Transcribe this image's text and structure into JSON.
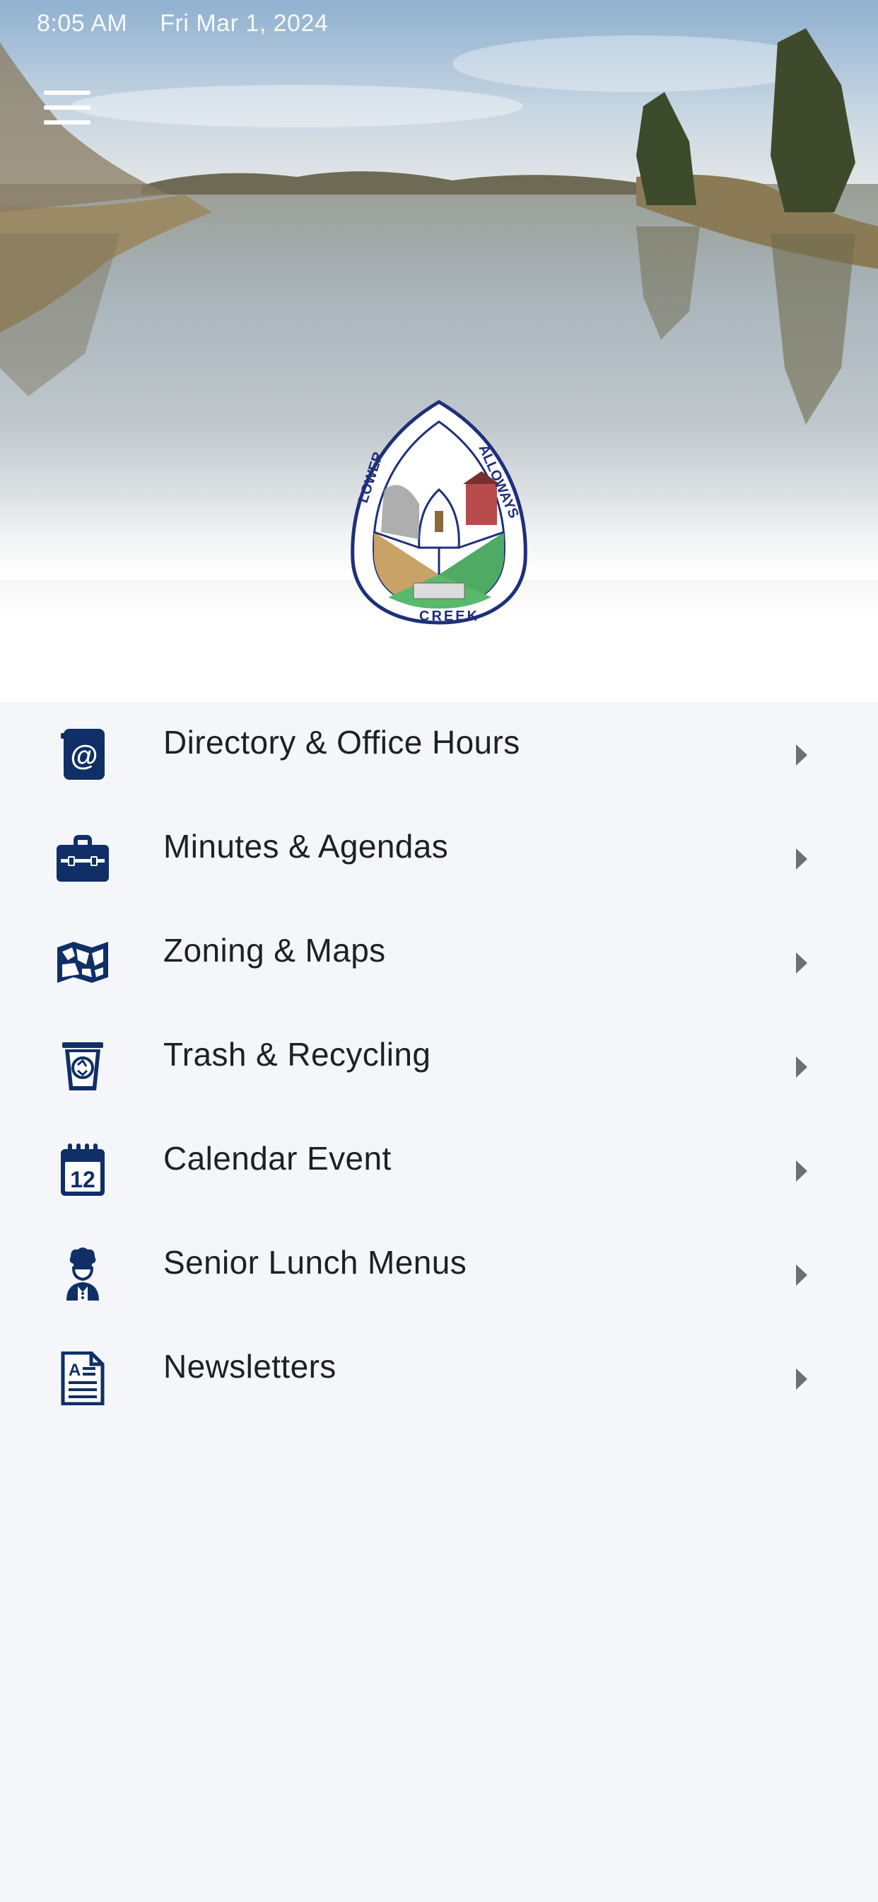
{
  "status_bar": {
    "time": "8:05 AM",
    "date": "Fri Mar 1, 2024"
  },
  "header": {
    "menu_icon": "hamburger-menu-icon"
  },
  "seal": {
    "top_text": "LOWER",
    "right_text": "ALLOWAYS",
    "bottom_text": "CREEK"
  },
  "menu": {
    "items": [
      {
        "label": "Directory & Office Hours",
        "icon": "address-book-icon"
      },
      {
        "label": "Minutes & Agendas",
        "icon": "briefcase-icon"
      },
      {
        "label": "Zoning & Maps",
        "icon": "map-icon"
      },
      {
        "label": "Trash & Recycling",
        "icon": "recycling-bin-icon"
      },
      {
        "label": "Calendar Event",
        "icon": "calendar-icon"
      },
      {
        "label": "Senior Lunch Menus",
        "icon": "chef-icon"
      },
      {
        "label": "Newsletters",
        "icon": "document-icon"
      }
    ]
  },
  "colors": {
    "icon_navy": "#0f2f66",
    "text": "#1f1f24",
    "background": "#f4f6f9",
    "chevron": "#6d6d72"
  }
}
